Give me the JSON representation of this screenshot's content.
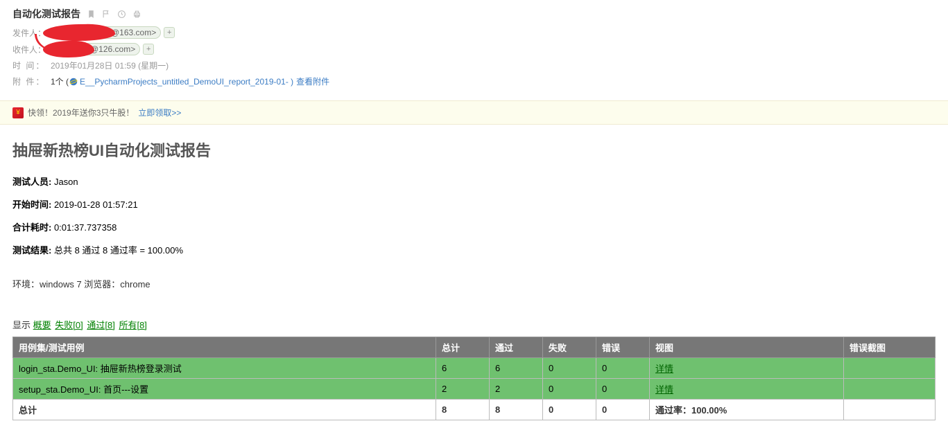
{
  "email": {
    "subject": "自动化测试报告",
    "sender_label": "发件人：",
    "sender_domain": "@163.com>",
    "recipient_label": "收件人：",
    "recipient_domain": "@126.com>",
    "time_label": "时   间：",
    "time_value": "2019年01月28日 01:59 (星期一)",
    "attach_label": "附   件：",
    "attach_count": "1个 ( ",
    "attach_name": "E__PycharmProjects_untitled_DemoUI_report_2019-01- )",
    "view_attach": "查看附件"
  },
  "promo": {
    "text": "快领！2019年送你3只牛股！",
    "link": "立即领取>>"
  },
  "report": {
    "title": "抽屉新热榜UI自动化测试报告",
    "tester_label": "测试人员:",
    "tester_value": " Jason",
    "start_label": "开始时间:",
    "start_value": " 2019-01-28 01:57:21",
    "duration_label": "合计耗时:",
    "duration_value": " 0:01:37.737358",
    "result_label": "测试结果:",
    "result_value": " 总共 8 通过 8 通过率 = 100.00%",
    "env": "环境：windows 7 浏览器：chrome"
  },
  "filters": {
    "show_label": "显示 ",
    "summary": "概要",
    "failed": "失败[0]",
    "passed": "通过[8]",
    "all": "所有[8]"
  },
  "table": {
    "headers": {
      "suite": "用例集/测试用例",
      "total": "总计",
      "pass": "通过",
      "fail": "失败",
      "error": "错误",
      "view": "视图",
      "screenshot": "错误截图"
    },
    "rows": [
      {
        "suite": "login_sta.Demo_UI: 抽屉新热榜登录测试",
        "total": "6",
        "pass": "6",
        "fail": "0",
        "error": "0",
        "view": "详情",
        "screenshot": ""
      },
      {
        "suite": "setup_sta.Demo_UI: 首页---设置",
        "total": "2",
        "pass": "2",
        "fail": "0",
        "error": "0",
        "view": "详情",
        "screenshot": ""
      }
    ],
    "footer": {
      "label": "总计",
      "total": "8",
      "pass": "8",
      "fail": "0",
      "error": "0",
      "rate": "通过率：100.00%",
      "screenshot": ""
    }
  }
}
